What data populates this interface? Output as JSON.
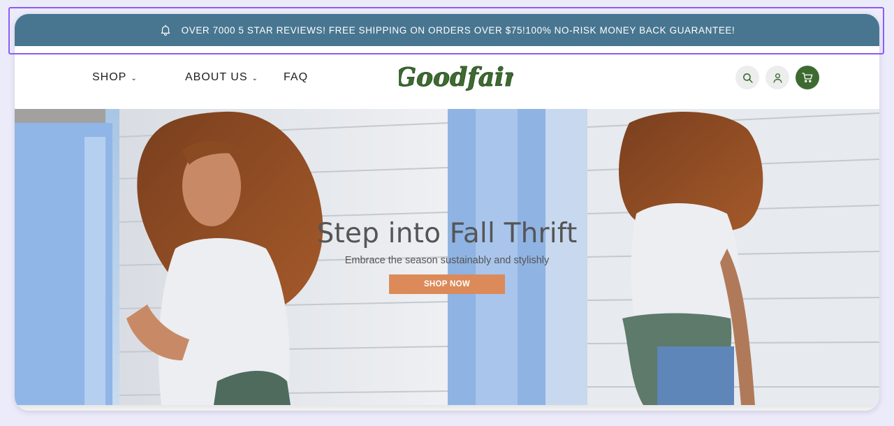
{
  "announcement": {
    "icon": "bell-icon",
    "text": "OVER 7000 5 STAR REVIEWS! FREE SHIPPING ON ORDERS OVER $75!100% NO-RISK MONEY BACK GUARANTEE!"
  },
  "nav": {
    "items": [
      {
        "label": "SHOP",
        "has_dropdown": true
      },
      {
        "label": "ABOUT US",
        "has_dropdown": true
      },
      {
        "label": "FAQ",
        "has_dropdown": false
      }
    ],
    "logo_text": "Goodfair",
    "icons": [
      "search-icon",
      "account-icon",
      "cart-icon"
    ]
  },
  "hero": {
    "title": "Step into Fall Thrift",
    "subtitle": "Embrace the season sustainably and stylishly",
    "cta_label": "SHOP NOW"
  },
  "colors": {
    "announcement_bg": "#487690",
    "brand_green": "#3d6a31",
    "cta_orange": "#dc8a59",
    "highlight_outline": "#8b5cf6"
  }
}
